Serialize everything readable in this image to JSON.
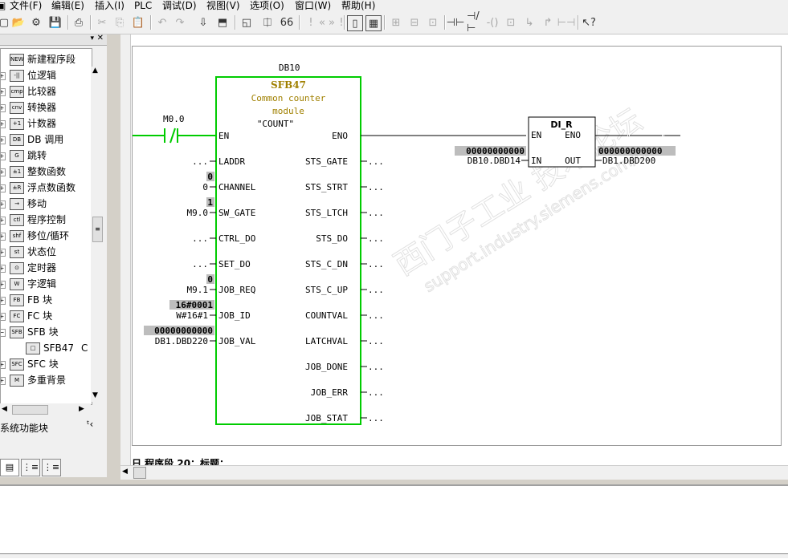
{
  "menubar": {
    "items": [
      "文件(F)",
      "编辑(E)",
      "插入(I)",
      "PLC",
      "调试(D)",
      "视图(V)",
      "选项(O)",
      "窗口(W)",
      "帮助(H)"
    ]
  },
  "tree": {
    "items": [
      {
        "label": "新建程序段",
        "icon": "new-network-icon",
        "badge": "NEW"
      },
      {
        "label": "位逻辑",
        "icon": "bit-logic-icon",
        "badge": "-||"
      },
      {
        "label": "比较器",
        "icon": "comparator-icon",
        "badge": "cmp"
      },
      {
        "label": "转换器",
        "icon": "converter-icon",
        "badge": "cnv"
      },
      {
        "label": "计数器",
        "icon": "counter-icon",
        "badge": "+1"
      },
      {
        "label": "DB 调用",
        "icon": "db-call-icon",
        "badge": "DB"
      },
      {
        "label": "跳转",
        "icon": "jump-icon",
        "badge": "G"
      },
      {
        "label": "整数函数",
        "icon": "integer-function-icon",
        "badge": "±1"
      },
      {
        "label": "浮点数函数",
        "icon": "float-function-icon",
        "badge": "±R"
      },
      {
        "label": "移动",
        "icon": "move-icon",
        "badge": "→"
      },
      {
        "label": "程序控制",
        "icon": "program-control-icon",
        "badge": "ctl"
      },
      {
        "label": "移位/循环",
        "icon": "shift-rotate-icon",
        "badge": "shf"
      },
      {
        "label": "状态位",
        "icon": "status-bit-icon",
        "badge": "st"
      },
      {
        "label": "定时器",
        "icon": "timer-icon",
        "badge": "⊙"
      },
      {
        "label": "字逻辑",
        "icon": "word-logic-icon",
        "badge": "W"
      },
      {
        "label": "FB 块",
        "icon": "fb-block-icon",
        "badge": "FB"
      },
      {
        "label": "FC 块",
        "icon": "fc-block-icon",
        "badge": "FC"
      },
      {
        "label": "SFB 块",
        "icon": "sfb-block-icon",
        "badge": "SFB"
      },
      {
        "label": "SFB47",
        "icon": "sfb47-block-icon",
        "badge": "□"
      },
      {
        "label": "SFC 块",
        "icon": "sfc-block-icon",
        "badge": "SFC"
      },
      {
        "label": "多重背景",
        "icon": "multi-instance-icon",
        "badge": "M"
      }
    ],
    "sfb47_suffix": "C"
  },
  "left_status": "系统功能块",
  "ladder": {
    "db_title": "DB10",
    "block_name": "SFB47",
    "block_desc_1": "Common counter",
    "block_desc_2": "module",
    "block_symbol": "\"COUNT\"",
    "contact_label": "M0.0",
    "en_label": "EN",
    "eno_label": "ENO",
    "left_pins": [
      {
        "name": "LADDR",
        "value": "...",
        "status": ""
      },
      {
        "name": "CHANNEL",
        "value": "0",
        "status": "0"
      },
      {
        "name": "SW_GATE",
        "value": "M9.0",
        "status": "1"
      },
      {
        "name": "CTRL_DO",
        "value": "...",
        "status": ""
      },
      {
        "name": "SET_DO",
        "value": "...",
        "status": ""
      },
      {
        "name": "JOB_REQ",
        "value": "M9.1",
        "status": "0"
      },
      {
        "name": "JOB_ID",
        "value": "W#16#1",
        "status": "16#0001"
      },
      {
        "name": "JOB_VAL",
        "value": "DB1.DBD220",
        "status": "00000000000"
      }
    ],
    "right_pins": [
      "STS_GATE",
      "STS_STRT",
      "STS_LTCH",
      "STS_DO",
      "STS_C_DN",
      "STS_C_UP",
      "COUNTVAL",
      "LATCHVAL",
      "JOB_DONE",
      "JOB_ERR",
      "JOB_STAT"
    ],
    "right_pin_value": "...",
    "dir_block": {
      "name": "DI_R",
      "en": "EN",
      "eno": "ENO",
      "in": "IN",
      "out": "OUT",
      "in_value": "DB10.DBD14",
      "in_status": "00000000000",
      "out_value": "DB1.DBD200",
      "out_status": "000000000000"
    },
    "next_network": "日 程序段 20：标题：",
    "watermark_1": "西门子工业  技术论坛",
    "watermark_2": "support.industry.siemens.com/cs"
  },
  "colors": {
    "block_border": "#00cc00",
    "block_name": "#a08000",
    "status_bg": "#bdbdbd",
    "wire_active": "#00cc00"
  }
}
